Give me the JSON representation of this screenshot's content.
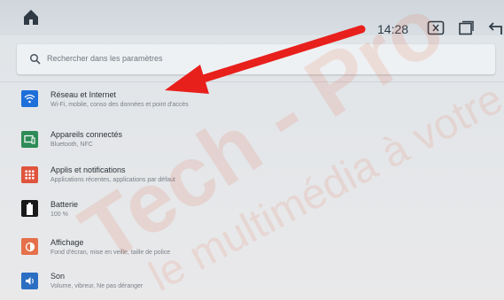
{
  "status_bar": {
    "time": "14:28",
    "icons": [
      "home-icon",
      "screenshot-icon",
      "recent-apps-icon",
      "back-icon"
    ]
  },
  "search": {
    "placeholder": "Rechercher dans les paramètres",
    "icon": "search-icon"
  },
  "settings": [
    {
      "title": "Réseau et Internet",
      "subtitle": "Wi-Fi, mobile, conso des données et point d'accès",
      "icon": "wifi-icon",
      "color": "#1e6fd9"
    },
    {
      "title": "Appareils connectés",
      "subtitle": "Bluetooth, NFC",
      "icon": "devices-icon",
      "color": "#2e8b57"
    },
    {
      "title": "Applis et notifications",
      "subtitle": "Applications récentes, applications par défaut",
      "icon": "apps-icon",
      "color": "#e0533c"
    },
    {
      "title": "Batterie",
      "subtitle": "100 %",
      "icon": "battery-icon",
      "color": "#1a1a1a"
    },
    {
      "title": "Affichage",
      "subtitle": "Fond d'écran, mise en veille, taille de police",
      "icon": "display-icon",
      "color": "#e5704a"
    },
    {
      "title": "Son",
      "subtitle": "Volume, vibreur, Ne pas déranger",
      "icon": "sound-icon",
      "color": "#2b6fc2"
    }
  ],
  "watermark": {
    "line1": "Tech - Pro",
    "line2": "le multimédia à votre"
  },
  "annotation": {
    "arrow_color": "#e8201c"
  }
}
